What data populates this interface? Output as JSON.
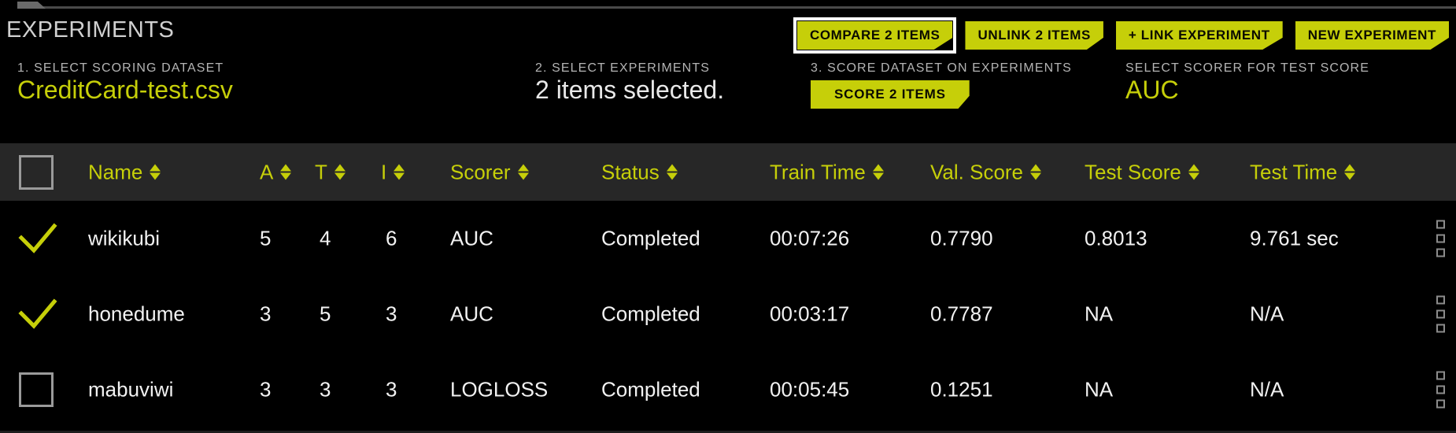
{
  "header": {
    "title": "EXPERIMENTS",
    "actions": [
      {
        "label": "COMPARE 2 ITEMS",
        "name": "compare-items-button",
        "selected": true
      },
      {
        "label": "UNLINK 2 ITEMS",
        "name": "unlink-items-button",
        "selected": false
      },
      {
        "label": "+ LINK EXPERIMENT",
        "name": "link-experiment-button",
        "selected": false
      },
      {
        "label": "NEW EXPERIMENT",
        "name": "new-experiment-button",
        "selected": false
      }
    ]
  },
  "steps": {
    "step1": {
      "label": "1. SELECT SCORING DATASET",
      "value": "CreditCard-test.csv"
    },
    "step2": {
      "label": "2. SELECT EXPERIMENTS",
      "value": "2 items selected."
    },
    "step3": {
      "label": "3. SCORE DATASET ON EXPERIMENTS",
      "button": "SCORE 2 ITEMS"
    },
    "step4": {
      "label": "SELECT SCORER FOR TEST SCORE",
      "value": "AUC"
    }
  },
  "table": {
    "columns": [
      {
        "key": "name",
        "label": "Name"
      },
      {
        "key": "a",
        "label": "A"
      },
      {
        "key": "t",
        "label": "T"
      },
      {
        "key": "i",
        "label": "I"
      },
      {
        "key": "scorer",
        "label": "Scorer"
      },
      {
        "key": "status",
        "label": "Status"
      },
      {
        "key": "train_time",
        "label": "Train Time"
      },
      {
        "key": "val_score",
        "label": "Val. Score"
      },
      {
        "key": "test_score",
        "label": "Test Score"
      },
      {
        "key": "test_time",
        "label": "Test Time"
      }
    ],
    "rows": [
      {
        "selected": true,
        "name": "wikikubi",
        "a": "5",
        "t": "4",
        "i": "6",
        "scorer": "AUC",
        "status": "Completed",
        "train_time": "00:07:26",
        "val_score": "0.7790",
        "test_score": "0.8013",
        "test_time": "9.761 sec"
      },
      {
        "selected": true,
        "name": "honedume",
        "a": "3",
        "t": "5",
        "i": "3",
        "scorer": "AUC",
        "status": "Completed",
        "train_time": "00:03:17",
        "val_score": "0.7787",
        "test_score": "NA",
        "test_time": "N/A"
      },
      {
        "selected": false,
        "name": "mabuviwi",
        "a": "3",
        "t": "3",
        "i": "3",
        "scorer": "LOGLOSS",
        "status": "Completed",
        "train_time": "00:05:45",
        "val_score": "0.1251",
        "test_score": "NA",
        "test_time": "N/A"
      }
    ]
  },
  "colors": {
    "accent": "#c6cf09",
    "background": "#000000",
    "header_row": "#272727",
    "muted_text": "#b4b4b4",
    "body_text": "#f2f2f2"
  }
}
